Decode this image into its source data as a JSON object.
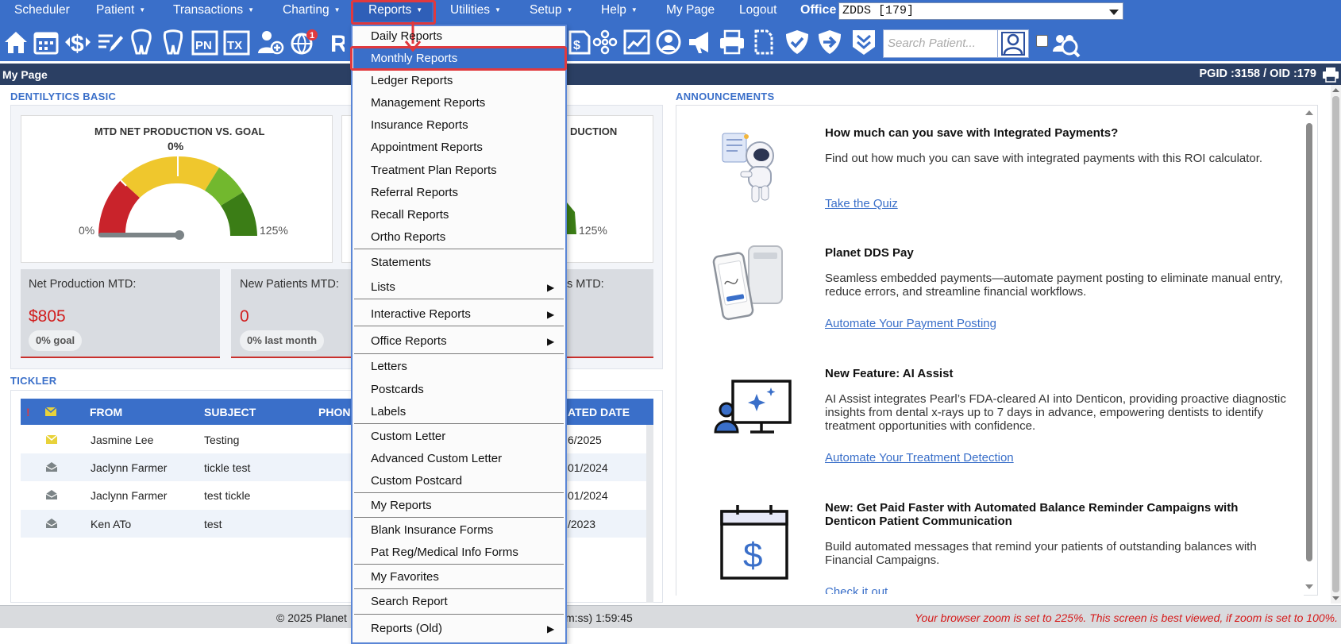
{
  "menubar": {
    "items": [
      "Scheduler",
      "Patient",
      "Transactions",
      "Charting",
      "Reports",
      "Utilities",
      "Setup",
      "Help",
      "My Page",
      "Logout"
    ],
    "office_label": "Office",
    "office_value": "ZDDS [179]"
  },
  "toolbar": {
    "search_placeholder": "Search Patient...",
    "badge_count": "1"
  },
  "page": {
    "title": "My Page",
    "ids": "PGID :3158  /  OID :179"
  },
  "dashboard": {
    "section_label": "DENTILYTICS BASIC",
    "gauge1": {
      "title": "MTD NET PRODUCTION VS. GOAL",
      "value_label": "0%",
      "min_label": "0%",
      "max_label": "125%",
      "value_percent": 0
    },
    "gauge2": {
      "title_partial": "DUCTION",
      "max_label": "125%"
    },
    "kpi": [
      {
        "label": "Net Production MTD:",
        "value": "$805",
        "pill": "0% goal"
      },
      {
        "label": "New Patients MTD:",
        "value": "0",
        "pill": "0% last month"
      },
      {
        "label": "s MTD:"
      }
    ]
  },
  "tickler": {
    "section_label": "TICKLER",
    "headers": {
      "urgent": "!",
      "from": "FROM",
      "subject": "SUBJECT",
      "phone": "PHON",
      "date": "ATED DATE"
    },
    "rows": [
      {
        "from": "Jasmine Lee",
        "subject": "Testing",
        "date": "6/2025"
      },
      {
        "from": "Jaclynn Farmer",
        "subject": "tickle test",
        "date": "01/2024"
      },
      {
        "from": "Jaclynn Farmer",
        "subject": "test tickle",
        "date": "01/2024"
      },
      {
        "from": "Ken ATo",
        "subject": "test",
        "date": "/2023"
      }
    ]
  },
  "announcements": {
    "section_label": "ANNOUNCEMENTS",
    "items": [
      {
        "title": "How much can you save with Integrated Payments?",
        "body": "Find out how much you can save with integrated payments with this ROI calculator.",
        "link": "Take the Quiz"
      },
      {
        "title": "Planet DDS Pay",
        "body": "Seamless embedded payments—automate payment posting to eliminate manual entry, reduce errors, and streamline financial workflows.",
        "link": "Automate Your Payment Posting"
      },
      {
        "title": "New Feature: AI Assist",
        "body": "AI Assist integrates Pearl’s FDA-cleared AI into Denticon, providing proactive diagnostic insights from dental x-rays up to 7 days in advance, empowering dentists to identify treatment opportunities with confidence.",
        "link": "Automate Your Treatment Detection"
      },
      {
        "title": "New: Get Paid Faster with Automated Balance Reminder Campaigns with Denticon Patient Communication",
        "body": "Build automated messages that remind your patients of outstanding balances with Financial Campaigns.",
        "link": "Check it out"
      }
    ]
  },
  "footer": {
    "copyright": "© 2025 Planet",
    "timer": "m:ss) 1:59:45",
    "zoom_warning": "Your browser zoom is set to 225%. This screen is best viewed, if zoom is set to 100%."
  },
  "reports_menu": {
    "items": [
      "Daily Reports",
      "Monthly Reports",
      "Ledger Reports",
      "Management Reports",
      "Insurance Reports",
      "Appointment Reports",
      "Treatment Plan Reports",
      "Referral Reports",
      "Recall Reports",
      "Ortho Reports",
      "Statements",
      "Lists",
      "Interactive Reports",
      "Office Reports",
      "Letters",
      "Postcards",
      "Labels",
      "Custom Letter",
      "Advanced Custom Letter",
      "Custom Postcard",
      "My Reports",
      "Blank Insurance Forms",
      "Pat Reg/Medical Info Forms",
      "My Favorites",
      "Search Report",
      "Reports (Old)"
    ],
    "selected": "Monthly Reports"
  },
  "colors": {
    "accent": "#3a6fc9",
    "navy": "#2b3f63",
    "highlight": "#e0393e",
    "kpi_red": "#d11e1e"
  }
}
